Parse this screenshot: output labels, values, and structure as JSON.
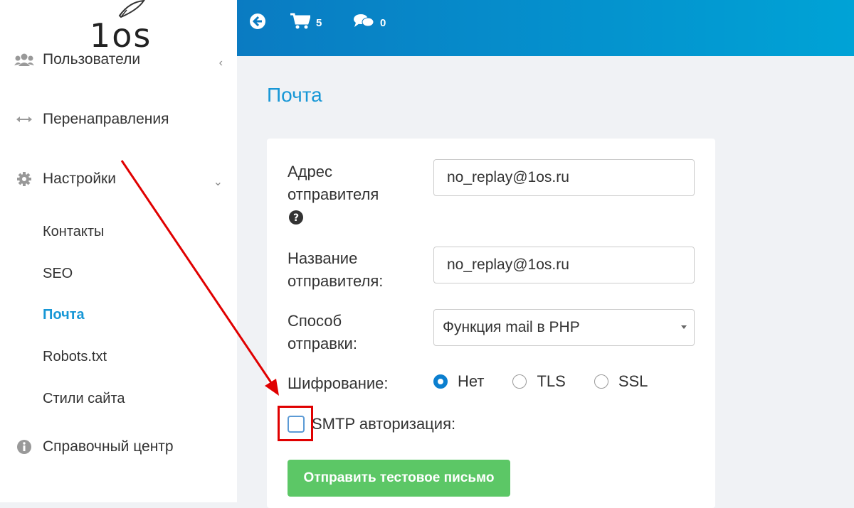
{
  "logo": {
    "text": "1os"
  },
  "sidebar": {
    "items": [
      {
        "label": "Пользователи",
        "icon": "users-icon"
      },
      {
        "label": "Перенаправления",
        "icon": "arrows-h-icon"
      },
      {
        "label": "Настройки",
        "icon": "gear-icon"
      },
      {
        "label": "Справочный центр",
        "icon": "info-icon"
      }
    ],
    "sub_items": [
      {
        "label": "Контакты"
      },
      {
        "label": "SEO"
      },
      {
        "label": "Почта",
        "active": true
      },
      {
        "label": "Robots.txt"
      },
      {
        "label": "Стили сайта"
      }
    ]
  },
  "topbar": {
    "cart_count": "5",
    "messages_count": "0"
  },
  "page": {
    "title": "Почта"
  },
  "form": {
    "sender_address_label": "Адрес отправителя",
    "sender_address_value": "no_replay@1os.ru",
    "sender_name_label": "Название отправителя:",
    "sender_name_value": "no_replay@1os.ru",
    "send_method_label": "Способ отправки:",
    "send_method_value": "Функция mail в PHP",
    "encryption_label": "Шифрование:",
    "encryption_options": [
      "Нет",
      "TLS",
      "SSL"
    ],
    "encryption_selected": "Нет",
    "smtp_auth_label": "SMTP авторизация:",
    "test_button_label": "Отправить тестовое письмо"
  },
  "colors": {
    "accent": "#1797d6",
    "topbar_start": "#0a7bc2",
    "topbar_end": "#00a3d6",
    "button_green": "#5cc766",
    "highlight_red": "#e00000"
  }
}
